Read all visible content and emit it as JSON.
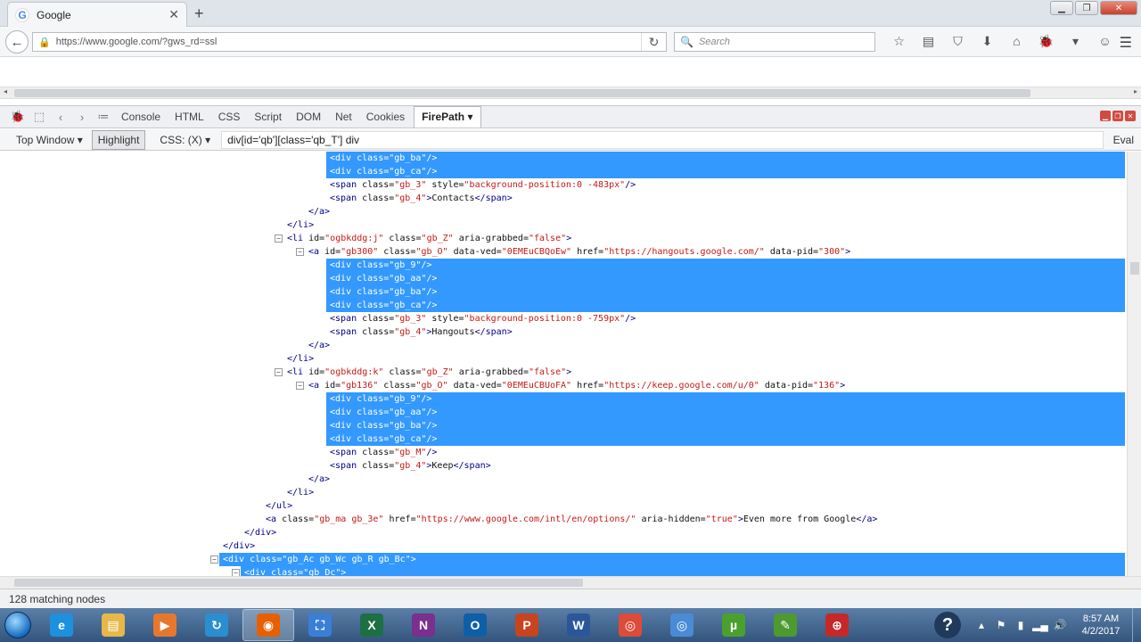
{
  "browser": {
    "tab_title": "Google",
    "tab_close": "✕",
    "new_tab": "+",
    "url": "https://www.google.com/?gws_rd=ssl",
    "search_placeholder": "Search"
  },
  "firebug": {
    "tabs": [
      "Console",
      "HTML",
      "CSS",
      "Script",
      "DOM",
      "Net",
      "Cookies"
    ],
    "active_tab": "FirePath ▾"
  },
  "firepath": {
    "window_select": "Top Window ▾",
    "highlight": "Highlight",
    "mode": "CSS: (X) ▾",
    "expression": "div[id='qb'][class='qb_T'] div",
    "eval": "Eval"
  },
  "code_lines": [
    {
      "indent": 370,
      "sel": true,
      "tw": null,
      "seg": [
        [
          "t",
          "<div "
        ],
        [
          "a",
          "class="
        ],
        [
          "v",
          "\"gb_ba\""
        ],
        [
          "t",
          "/>"
        ]
      ]
    },
    {
      "indent": 370,
      "sel": true,
      "tw": null,
      "seg": [
        [
          "t",
          "<div "
        ],
        [
          "a",
          "class="
        ],
        [
          "v",
          "\"gb_ca\""
        ],
        [
          "t",
          "/>"
        ]
      ]
    },
    {
      "indent": 370,
      "sel": false,
      "tw": null,
      "seg": [
        [
          "t",
          "<span "
        ],
        [
          "a",
          "class="
        ],
        [
          "v",
          "\"gb_3\""
        ],
        [
          "a",
          " style="
        ],
        [
          "v",
          "\"background-position:0 -483px\""
        ],
        [
          "t",
          "/>"
        ]
      ]
    },
    {
      "indent": 370,
      "sel": false,
      "tw": null,
      "seg": [
        [
          "t",
          "<span "
        ],
        [
          "a",
          "class="
        ],
        [
          "v",
          "\"gb_4\""
        ],
        [
          "t",
          ">"
        ],
        [
          "a",
          "Contacts"
        ],
        [
          "t",
          "</span>"
        ]
      ]
    },
    {
      "indent": 346,
      "sel": false,
      "tw": null,
      "seg": [
        [
          "t",
          "</a>"
        ]
      ]
    },
    {
      "indent": 322,
      "sel": false,
      "tw": null,
      "seg": [
        [
          "t",
          "</li>"
        ]
      ]
    },
    {
      "indent": 322,
      "sel": false,
      "tw": 308,
      "seg": [
        [
          "t",
          "<li "
        ],
        [
          "a",
          "id="
        ],
        [
          "v",
          "\"ogbkddg:j\""
        ],
        [
          "a",
          " class="
        ],
        [
          "v",
          "\"gb_Z\""
        ],
        [
          "a",
          " aria-grabbed="
        ],
        [
          "v",
          "\"false\""
        ],
        [
          "t",
          ">"
        ]
      ]
    },
    {
      "indent": 346,
      "sel": false,
      "tw": 332,
      "seg": [
        [
          "t",
          "<a "
        ],
        [
          "a",
          "id="
        ],
        [
          "v",
          "\"gb300\""
        ],
        [
          "a",
          " class="
        ],
        [
          "v",
          "\"gb_O\""
        ],
        [
          "a",
          " data-ved="
        ],
        [
          "v",
          "\"0EMEuCBQoEw\""
        ],
        [
          "a",
          " href="
        ],
        [
          "v",
          "\"https://hangouts.google.com/\""
        ],
        [
          "a",
          " data-pid="
        ],
        [
          "v",
          "\"300\""
        ],
        [
          "t",
          ">"
        ]
      ]
    },
    {
      "indent": 370,
      "sel": true,
      "tw": null,
      "seg": [
        [
          "t",
          "<div "
        ],
        [
          "a",
          "class="
        ],
        [
          "v",
          "\"gb_9\""
        ],
        [
          "t",
          "/>"
        ]
      ]
    },
    {
      "indent": 370,
      "sel": true,
      "tw": null,
      "seg": [
        [
          "t",
          "<div "
        ],
        [
          "a",
          "class="
        ],
        [
          "v",
          "\"gb_aa\""
        ],
        [
          "t",
          "/>"
        ]
      ]
    },
    {
      "indent": 370,
      "sel": true,
      "tw": null,
      "seg": [
        [
          "t",
          "<div "
        ],
        [
          "a",
          "class="
        ],
        [
          "v",
          "\"gb_ba\""
        ],
        [
          "t",
          "/>"
        ]
      ]
    },
    {
      "indent": 370,
      "sel": true,
      "tw": null,
      "seg": [
        [
          "t",
          "<div "
        ],
        [
          "a",
          "class="
        ],
        [
          "v",
          "\"gb_ca\""
        ],
        [
          "t",
          "/>"
        ]
      ]
    },
    {
      "indent": 370,
      "sel": false,
      "tw": null,
      "seg": [
        [
          "t",
          "<span "
        ],
        [
          "a",
          "class="
        ],
        [
          "v",
          "\"gb_3\""
        ],
        [
          "a",
          " style="
        ],
        [
          "v",
          "\"background-position:0 -759px\""
        ],
        [
          "t",
          "/>"
        ]
      ]
    },
    {
      "indent": 370,
      "sel": false,
      "tw": null,
      "seg": [
        [
          "t",
          "<span "
        ],
        [
          "a",
          "class="
        ],
        [
          "v",
          "\"gb_4\""
        ],
        [
          "t",
          ">"
        ],
        [
          "a",
          "Hangouts"
        ],
        [
          "t",
          "</span>"
        ]
      ]
    },
    {
      "indent": 346,
      "sel": false,
      "tw": null,
      "seg": [
        [
          "t",
          "</a>"
        ]
      ]
    },
    {
      "indent": 322,
      "sel": false,
      "tw": null,
      "seg": [
        [
          "t",
          "</li>"
        ]
      ]
    },
    {
      "indent": 322,
      "sel": false,
      "tw": 308,
      "seg": [
        [
          "t",
          "<li "
        ],
        [
          "a",
          "id="
        ],
        [
          "v",
          "\"ogbkddg:k\""
        ],
        [
          "a",
          " class="
        ],
        [
          "v",
          "\"gb_Z\""
        ],
        [
          "a",
          " aria-grabbed="
        ],
        [
          "v",
          "\"false\""
        ],
        [
          "t",
          ">"
        ]
      ]
    },
    {
      "indent": 346,
      "sel": false,
      "tw": 332,
      "seg": [
        [
          "t",
          "<a "
        ],
        [
          "a",
          "id="
        ],
        [
          "v",
          "\"gb136\""
        ],
        [
          "a",
          " class="
        ],
        [
          "v",
          "\"gb_O\""
        ],
        [
          "a",
          " data-ved="
        ],
        [
          "v",
          "\"0EMEuCBUoFA\""
        ],
        [
          "a",
          " href="
        ],
        [
          "v",
          "\"https://keep.google.com/u/0\""
        ],
        [
          "a",
          " data-pid="
        ],
        [
          "v",
          "\"136\""
        ],
        [
          "t",
          ">"
        ]
      ]
    },
    {
      "indent": 370,
      "sel": true,
      "tw": null,
      "seg": [
        [
          "t",
          "<div "
        ],
        [
          "a",
          "class="
        ],
        [
          "v",
          "\"gb_9\""
        ],
        [
          "t",
          "/>"
        ]
      ]
    },
    {
      "indent": 370,
      "sel": true,
      "tw": null,
      "seg": [
        [
          "t",
          "<div "
        ],
        [
          "a",
          "class="
        ],
        [
          "v",
          "\"gb_aa\""
        ],
        [
          "t",
          "/>"
        ]
      ]
    },
    {
      "indent": 370,
      "sel": true,
      "tw": null,
      "seg": [
        [
          "t",
          "<div "
        ],
        [
          "a",
          "class="
        ],
        [
          "v",
          "\"gb_ba\""
        ],
        [
          "t",
          "/>"
        ]
      ]
    },
    {
      "indent": 370,
      "sel": true,
      "tw": null,
      "seg": [
        [
          "t",
          "<div "
        ],
        [
          "a",
          "class="
        ],
        [
          "v",
          "\"gb_ca\""
        ],
        [
          "t",
          "/>"
        ]
      ]
    },
    {
      "indent": 370,
      "sel": false,
      "tw": null,
      "seg": [
        [
          "t",
          "<span "
        ],
        [
          "a",
          "class="
        ],
        [
          "v",
          "\"gb_M\""
        ],
        [
          "t",
          "/>"
        ]
      ]
    },
    {
      "indent": 370,
      "sel": false,
      "tw": null,
      "seg": [
        [
          "t",
          "<span "
        ],
        [
          "a",
          "class="
        ],
        [
          "v",
          "\"gb_4\""
        ],
        [
          "t",
          ">"
        ],
        [
          "a",
          "Keep"
        ],
        [
          "t",
          "</span>"
        ]
      ]
    },
    {
      "indent": 346,
      "sel": false,
      "tw": null,
      "seg": [
        [
          "t",
          "</a>"
        ]
      ]
    },
    {
      "indent": 322,
      "sel": false,
      "tw": null,
      "seg": [
        [
          "t",
          "</li>"
        ]
      ]
    },
    {
      "indent": 298,
      "sel": false,
      "tw": null,
      "seg": [
        [
          "t",
          "</ul>"
        ]
      ]
    },
    {
      "indent": 298,
      "sel": false,
      "tw": null,
      "seg": [
        [
          "t",
          "<a "
        ],
        [
          "a",
          "class="
        ],
        [
          "v",
          "\"gb_ma gb_3e\""
        ],
        [
          "a",
          " href="
        ],
        [
          "v",
          "\"https://www.google.com/intl/en/options/\""
        ],
        [
          "a",
          " aria-hidden="
        ],
        [
          "v",
          "\"true\""
        ],
        [
          "t",
          ">"
        ],
        [
          "a",
          "Even more from Google"
        ],
        [
          "t",
          "</a>"
        ]
      ]
    },
    {
      "indent": 274,
      "sel": false,
      "tw": null,
      "seg": [
        [
          "t",
          "</div>"
        ]
      ]
    },
    {
      "indent": 250,
      "sel": false,
      "tw": null,
      "seg": [
        [
          "t",
          "</div>"
        ]
      ]
    },
    {
      "indent": 250,
      "sel": true,
      "tw": 236,
      "seg": [
        [
          "t",
          "<div "
        ],
        [
          "a",
          "class="
        ],
        [
          "v",
          "\"gb_Ac gb_Wc gb_R gb_Bc\""
        ],
        [
          "t",
          ">"
        ]
      ]
    },
    {
      "indent": 274,
      "sel": true,
      "tw": 260,
      "seg": [
        [
          "t",
          "<div "
        ],
        [
          "a",
          "class="
        ],
        [
          "v",
          "\"gb_Dc\""
        ],
        [
          "t",
          ">"
        ]
      ]
    }
  ],
  "status": "128 matching nodes",
  "taskbar": {
    "apps": [
      {
        "name": "ie",
        "glyph": "e",
        "color": "#1e90e0"
      },
      {
        "name": "explorer",
        "glyph": "▤",
        "color": "#e6b84a"
      },
      {
        "name": "media",
        "glyph": "▶",
        "color": "#e8772e"
      },
      {
        "name": "app4",
        "glyph": "↻",
        "color": "#2a8fd0"
      },
      {
        "name": "firefox",
        "glyph": "◉",
        "color": "#e66000"
      },
      {
        "name": "snip",
        "glyph": "⛶",
        "color": "#3a7fd5"
      },
      {
        "name": "excel",
        "glyph": "X",
        "color": "#1d7044"
      },
      {
        "name": "onenote",
        "glyph": "N",
        "color": "#7b2f8e"
      },
      {
        "name": "outlook",
        "glyph": "O",
        "color": "#0f5fa8"
      },
      {
        "name": "powerpoint",
        "glyph": "P",
        "color": "#c8431e"
      },
      {
        "name": "word",
        "glyph": "W",
        "color": "#2b579a"
      },
      {
        "name": "chrome",
        "glyph": "◎",
        "color": "#dd4b39"
      },
      {
        "name": "chrome2",
        "glyph": "◎",
        "color": "#4a8bd6"
      },
      {
        "name": "utorrent",
        "glyph": "µ",
        "color": "#4aa02c"
      },
      {
        "name": "project",
        "glyph": "✎",
        "color": "#4d9a2f"
      },
      {
        "name": "network",
        "glyph": "⊕",
        "color": "#c62828"
      }
    ],
    "active_app": "firefox",
    "time": "8:57 AM",
    "date": "4/2/2017"
  }
}
